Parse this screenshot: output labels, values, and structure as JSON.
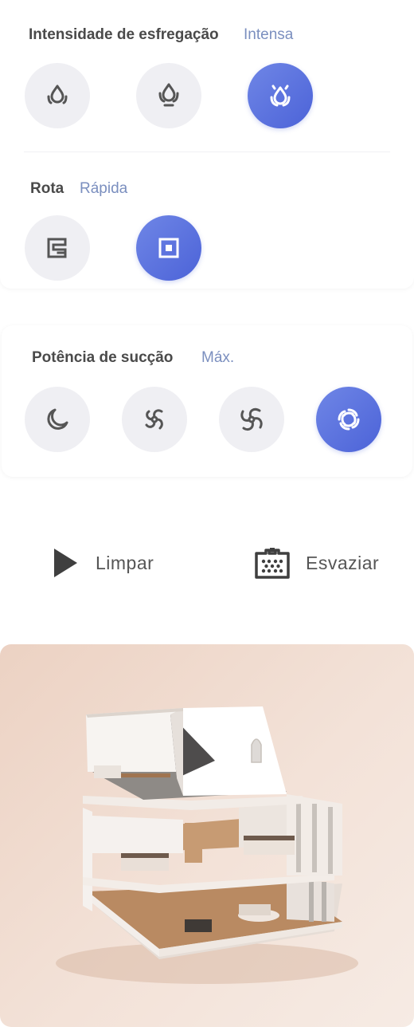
{
  "scrub": {
    "title": "Intensidade de esfregação",
    "value": "Intensa",
    "options": [
      {
        "icon": "water-drop-low-icon",
        "selected": false
      },
      {
        "icon": "water-drop-medium-icon",
        "selected": false
      },
      {
        "icon": "water-drop-high-icon",
        "selected": true
      }
    ]
  },
  "route": {
    "title": "Rota",
    "value": "Rápida",
    "options": [
      {
        "icon": "route-zigzag-icon",
        "selected": false
      },
      {
        "icon": "route-quick-icon",
        "selected": true
      }
    ]
  },
  "suction": {
    "title": "Potência de sucção",
    "value": "Máx.",
    "options": [
      {
        "icon": "moon-quiet-icon",
        "selected": false
      },
      {
        "icon": "fan-standard-icon",
        "selected": false
      },
      {
        "icon": "fan-turbo-icon",
        "selected": false
      },
      {
        "icon": "fan-max-icon",
        "selected": true
      }
    ]
  },
  "actions": {
    "clean_label": "Limpar",
    "empty_label": "Esvaziar"
  },
  "colors": {
    "accent": "#5a70e0",
    "value_text": "#7b8fbf",
    "option_bg": "#efeff3"
  }
}
